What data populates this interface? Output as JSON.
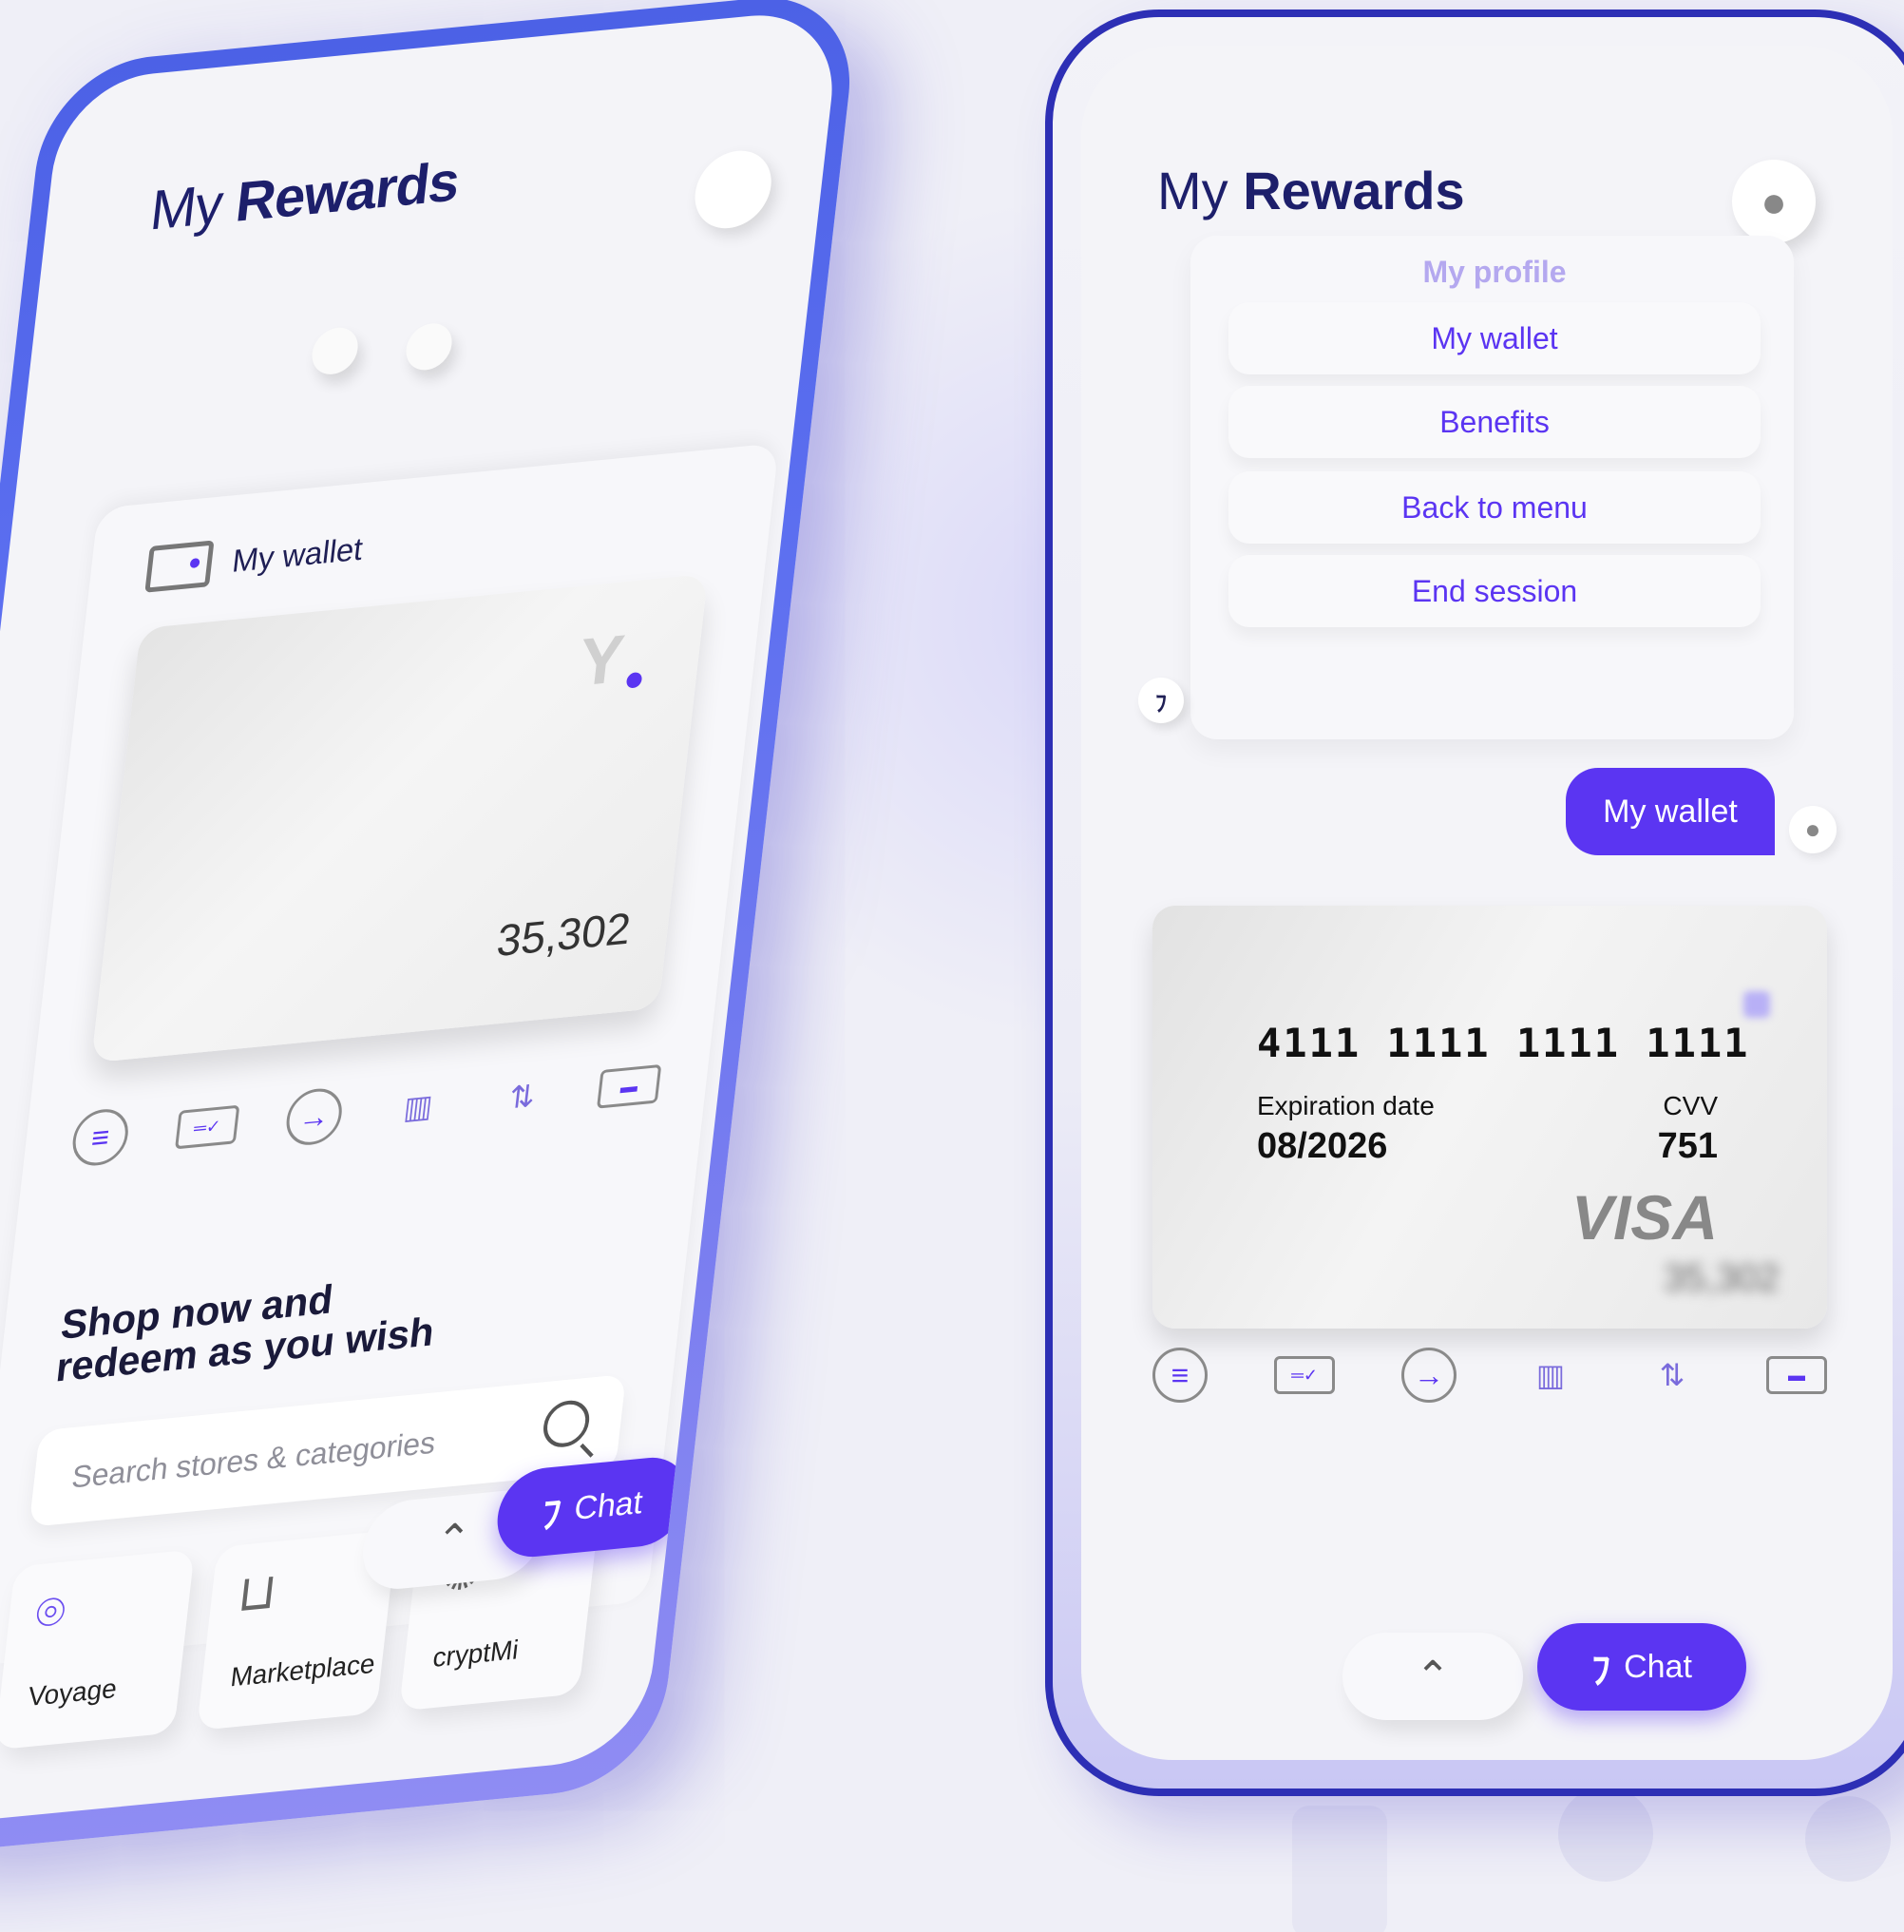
{
  "left_phone": {
    "title_light": "My",
    "title_bold": "Rewards",
    "avatar_icon": "user-icon",
    "wallet_label": "My wallet",
    "card_balance": "35,302",
    "card_logo": "Y",
    "actions": [
      "menu-icon",
      "card-check-icon",
      "arrow-right-icon",
      "chart-icon",
      "transfer-icon",
      "card-icon"
    ],
    "shop_line1": "Shop now and",
    "shop_line2": "redeem as you wish",
    "search_placeholder": "Search stores & categories",
    "categories": [
      {
        "label": "Voyage",
        "icon": "location-pin-icon"
      },
      {
        "label": "Marketplace",
        "icon": "cart-icon"
      },
      {
        "label": "cryptMi",
        "icon": "crypto-icon"
      }
    ],
    "chat_label": "Chat"
  },
  "right_phone": {
    "title_light": "My",
    "title_bold": "Rewards",
    "menu": [
      "My profile",
      "My wallet",
      "Benefits",
      "Back to menu",
      "End session"
    ],
    "message": "My wallet",
    "card": {
      "number": "4111 1111 1111 1111",
      "exp_label": "Expiration date",
      "exp_value": "08/2026",
      "cvv_label": "CVV",
      "cvv_value": "751",
      "brand": "VISA",
      "balance_blurred": "35,302"
    },
    "chat_label": "Chat"
  },
  "colors": {
    "accent": "#5b35f2",
    "frame": "#2d2fb5",
    "title": "#1d1f6b"
  }
}
